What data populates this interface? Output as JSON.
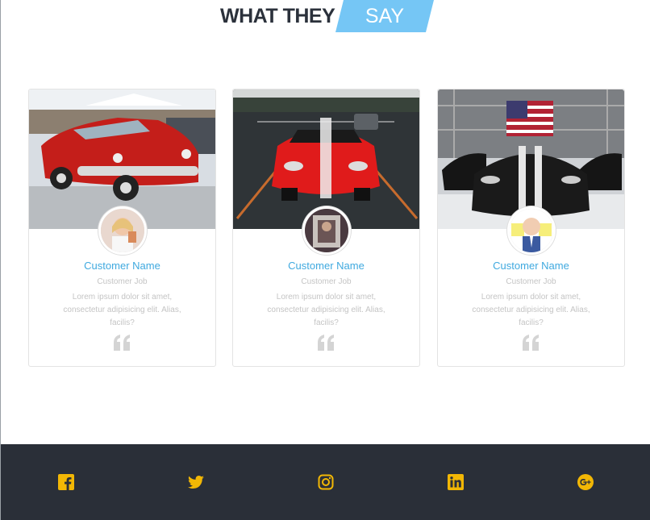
{
  "heading": {
    "main": "WHAT THEY",
    "highlight": "SAY"
  },
  "colors": {
    "accent": "#75c6f5",
    "name": "#3fa9df",
    "footer_bg": "#2a2f38",
    "social": "#f2b705"
  },
  "cards": [
    {
      "name": "Customer Name",
      "job": "Customer Job",
      "text": "Lorem ipsum dolor sit amet, consectetur adipisicing elit. Alias, facilis?",
      "quote_icon": "quote-icon"
    },
    {
      "name": "Customer Name",
      "job": "Customer Job",
      "text": "Lorem ipsum dolor sit amet, consectetur adipisicing elit. Alias, facilis?",
      "quote_icon": "quote-icon"
    },
    {
      "name": "Customer Name",
      "job": "Customer Job",
      "text": "Lorem ipsum dolor sit amet, consectetur adipisicing elit. Alias, facilis?",
      "quote_icon": "quote-icon"
    }
  ],
  "footer": {
    "social": [
      "facebook-icon",
      "twitter-icon",
      "instagram-icon",
      "linkedin-icon",
      "google-plus-icon"
    ]
  }
}
